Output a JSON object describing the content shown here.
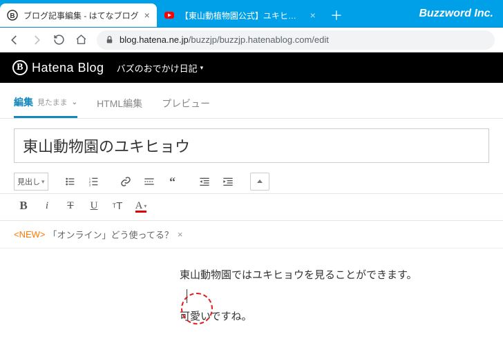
{
  "browser": {
    "tabs": [
      {
        "label": "ブログ記事編集 - はてなブログ",
        "active": true,
        "favicon": "hatena"
      },
      {
        "label": "【東山動植物園公式】ユキヒョウの鳴",
        "active": false,
        "favicon": "youtube"
      }
    ],
    "watermark": "Buzzword Inc.",
    "url_host": "blog.hatena.ne.jp",
    "url_path": "/buzzjp/buzzjp.hatenablog.com/edit"
  },
  "hatena": {
    "brand": "Hatena Blog",
    "blog_name": "バズのおでかけ日記"
  },
  "editor_tabs": {
    "edit": "編集",
    "edit_sub": "見たまま",
    "html": "HTML編集",
    "preview": "プレビュー"
  },
  "post": {
    "title": "東山動物園のユキヒョウ",
    "heading_selector": "見出し",
    "body_line1": "東山動物園ではユキヒョウを見ることができます。",
    "body_line3": "可愛いですね。"
  },
  "notice": {
    "new": "<NEW>",
    "text": "「オンライン」どう使ってる？",
    "close": "×"
  }
}
